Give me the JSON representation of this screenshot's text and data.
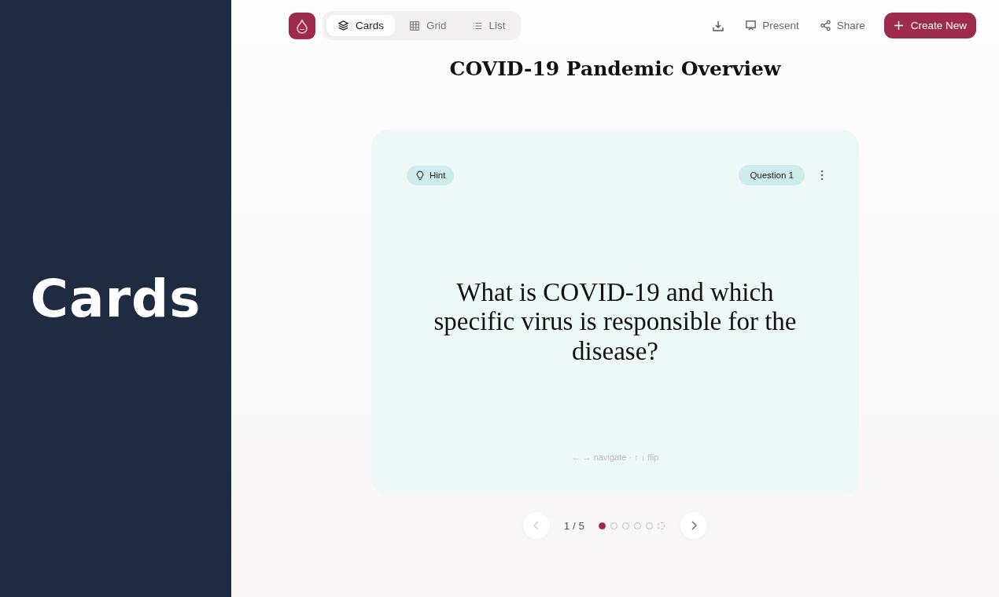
{
  "side_panel": {
    "title": "Cards"
  },
  "view_tabs": [
    {
      "label": "Cards",
      "kind": "cards",
      "selected": true
    },
    {
      "label": "Grid",
      "kind": "grid",
      "selected": false
    },
    {
      "label": "List",
      "kind": "list",
      "selected": false
    }
  ],
  "actions": [
    {
      "kind": "download"
    },
    {
      "kind": "present",
      "label": "Present"
    },
    {
      "kind": "share",
      "label": "Share"
    },
    {
      "kind": "create",
      "label": "Create New"
    }
  ],
  "deck_title": "COVID-19 Pandemic Overview",
  "card": {
    "hint": "Hint",
    "badge": "Question 1",
    "question": "What is COVID-19 and which specific virus is responsible for the disease?",
    "shortcut_hint": "← → navigate · ↑ ↓ flip"
  },
  "pager": {
    "prev_disabled": true,
    "counter": "1 / 5",
    "dots": [
      {
        "kind": "dot",
        "selected": true
      },
      {
        "kind": "dot",
        "selected": false
      },
      {
        "kind": "dot",
        "selected": false
      },
      {
        "kind": "dot",
        "selected": false
      },
      {
        "kind": "dot",
        "selected": false
      },
      {
        "kind": "dashed",
        "selected": false
      }
    ]
  }
}
